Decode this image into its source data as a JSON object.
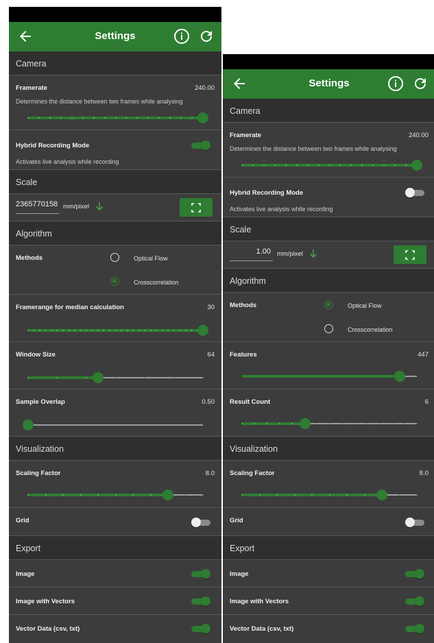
{
  "left": {
    "title": "Settings",
    "sections": {
      "camera": "Camera",
      "scale": "Scale",
      "algorithm": "Algorithm",
      "visualization": "Visualization",
      "export": "Export"
    },
    "framerate": {
      "label": "Framerate",
      "value": "240.00",
      "desc": "Determines the distance between two frames while analysing",
      "level": 1.0
    },
    "hybrid": {
      "label": "Hybrid Recording Mode",
      "desc": "Activates live analysis while recording",
      "on": true
    },
    "scale_value": "2365770158",
    "unit": "mm/pixel",
    "methods": {
      "label": "Methods",
      "options": [
        "Optical Flow",
        "Crosscorrelation"
      ],
      "selected": "Crosscorrelation"
    },
    "framerange": {
      "label": "Framerange for median calculation",
      "value": "30",
      "level": 1.0
    },
    "window_size": {
      "label": "Window Size",
      "value": "64",
      "level": 0.4
    },
    "sample_overlap": {
      "label": "Sample Overlap",
      "value": "0.50",
      "level": 0.0
    },
    "scaling_factor": {
      "label": "Scaling Factor",
      "value": "8.0",
      "level": 0.8
    },
    "grid": {
      "label": "Grid",
      "on": false
    },
    "export_image": {
      "label": "Image",
      "on": true
    },
    "export_vectors": {
      "label": "Image with Vectors",
      "on": true
    },
    "export_data": {
      "label": "Vector Data (csv, txt)",
      "on": true
    }
  },
  "right": {
    "title": "Settings",
    "sections": {
      "camera": "Camera",
      "scale": "Scale",
      "algorithm": "Algorithm",
      "visualization": "Visualization",
      "export": "Export"
    },
    "framerate": {
      "label": "Framerate",
      "value": "240.00",
      "desc": "Determines the distance between two frames while analysing",
      "level": 1.0
    },
    "hybrid": {
      "label": "Hybrid Recording Mode",
      "desc": "Activates live analysis while recording",
      "on": false
    },
    "scale_value": "1.00",
    "unit": "mm/pixel",
    "methods": {
      "label": "Methods",
      "options": [
        "Optical Flow",
        "Crosscorrelation"
      ],
      "selected": "Optical Flow"
    },
    "features": {
      "label": "Features",
      "value": "447",
      "level": 0.9
    },
    "result_count": {
      "label": "Result Count",
      "value": "6",
      "level": 0.36
    },
    "scaling_factor": {
      "label": "Scaling Factor",
      "value": "8.0",
      "level": 0.8
    },
    "grid": {
      "label": "Grid",
      "on": false
    },
    "export_image": {
      "label": "Image",
      "on": true
    },
    "export_vectors": {
      "label": "Image with Vectors",
      "on": true
    },
    "export_data": {
      "label": "Vector Data (csv, txt)",
      "on": true
    }
  },
  "colors": {
    "accent": "#2e7d32",
    "background": "#3c3c3c",
    "section": "#2f2f2f",
    "statusbar": "#000000"
  },
  "icons": {
    "back": "arrow-back-icon",
    "info": "info-icon",
    "refresh": "refresh-icon",
    "fullscreen": "fullscreen-icon",
    "sort": "arrow-down-icon"
  }
}
